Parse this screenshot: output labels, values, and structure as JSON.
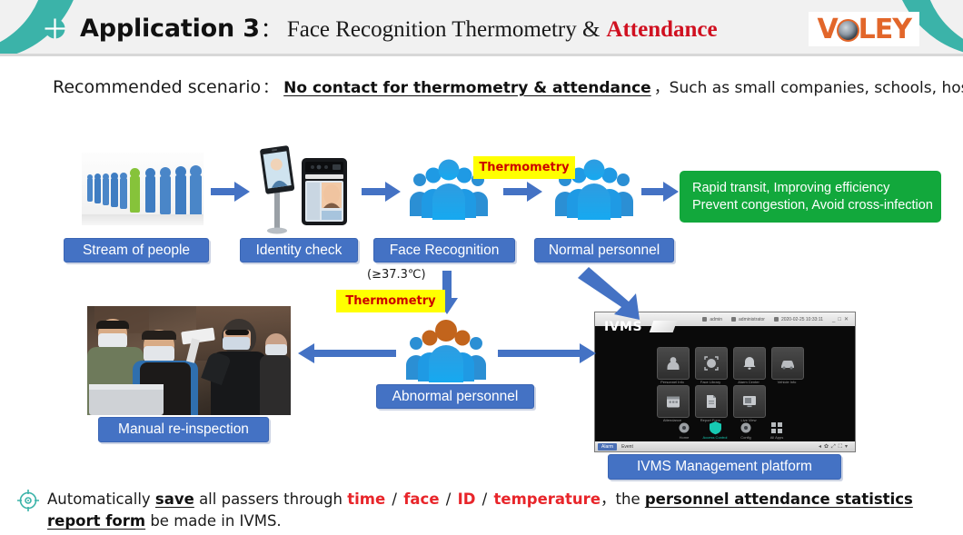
{
  "header": {
    "bullet_icon": "crosshair-circle-icon",
    "title_strong": "Application 3",
    "title_colon": "：",
    "title_serif": "Face Recognition Thermometry &",
    "title_highlight": "Attendance",
    "logo_part1": "V",
    "logo_part2": "LEY",
    "logo_icon": "camera-lens-icon",
    "teal_color": "#3bb3a9",
    "highlight_color": "#d01020",
    "logo_color": "#e2662a"
  },
  "scenario": {
    "label": "Recommended scenario",
    "colon": "：",
    "emphasis": "No contact for thermometry & attendance",
    "rest": "，Such as small companies, schools, hospitals etc."
  },
  "flow": {
    "chips": [
      {
        "label": "Stream of people"
      },
      {
        "label": "Identity check"
      },
      {
        "label": "Face Recognition"
      },
      {
        "label": "Normal personnel"
      },
      {
        "label": "Abnormal personnel"
      },
      {
        "label": "Manual re-inspection"
      },
      {
        "label": "IVMS Management platform"
      }
    ],
    "tags": [
      {
        "label": "Thermometry"
      },
      {
        "label": "Thermometry"
      }
    ],
    "temperature_note": "(≥37.3℃)",
    "outcome": {
      "line1": "Rapid transit, Improving efficiency",
      "line2": "Prevent congestion, Avoid cross-infection",
      "color": "#12a83c"
    },
    "chip_color": "#4472c4",
    "arrow_color": "#4472c4"
  },
  "ivms": {
    "logo": "IVMS",
    "topbar": [
      {
        "icon": "user-icon",
        "label": "admin"
      },
      {
        "icon": "shield-icon",
        "label": "administrator"
      },
      {
        "icon": "clock-icon",
        "label": "2020-02-25 10:33:11"
      }
    ],
    "tiles_row1": [
      {
        "icon": "person-icon",
        "label": "Personnel Info"
      },
      {
        "icon": "face-scan-icon",
        "label": "Face Library"
      },
      {
        "icon": "alarm-icon",
        "label": "Alarm Center"
      },
      {
        "icon": "vehicle-icon",
        "label": "Vehicle Info"
      }
    ],
    "tiles_row2": [
      {
        "icon": "calendar-icon",
        "label": "Attendance"
      },
      {
        "icon": "document-icon",
        "label": "Report Form"
      },
      {
        "icon": "monitor-icon",
        "label": "Live View"
      }
    ],
    "nav": [
      {
        "icon": "circle-icon",
        "label": "Home"
      },
      {
        "icon": "shield-green-icon",
        "label": "Access Control"
      },
      {
        "icon": "circle-icon",
        "label": "Config"
      },
      {
        "icon": "grid-icon",
        "label": "All Apps"
      }
    ],
    "bottom_tabs": [
      {
        "label": "Alarm"
      },
      {
        "label": "Event"
      }
    ]
  },
  "footer": {
    "p1": "Automatically ",
    "b1": "save",
    "p2": " all passers through ",
    "r1": "time",
    "s1": " / ",
    "r2": "face",
    "s2": " / ",
    "r3": "ID",
    "s3": " / ",
    "r4": "temperature",
    "p3": "，the ",
    "b2": "personnel attendance statistics",
    "b3": "report form",
    "p4": " be made in IVMS.",
    "target_icon": "target-crosshair-icon",
    "accent_color": "#e8252a"
  }
}
